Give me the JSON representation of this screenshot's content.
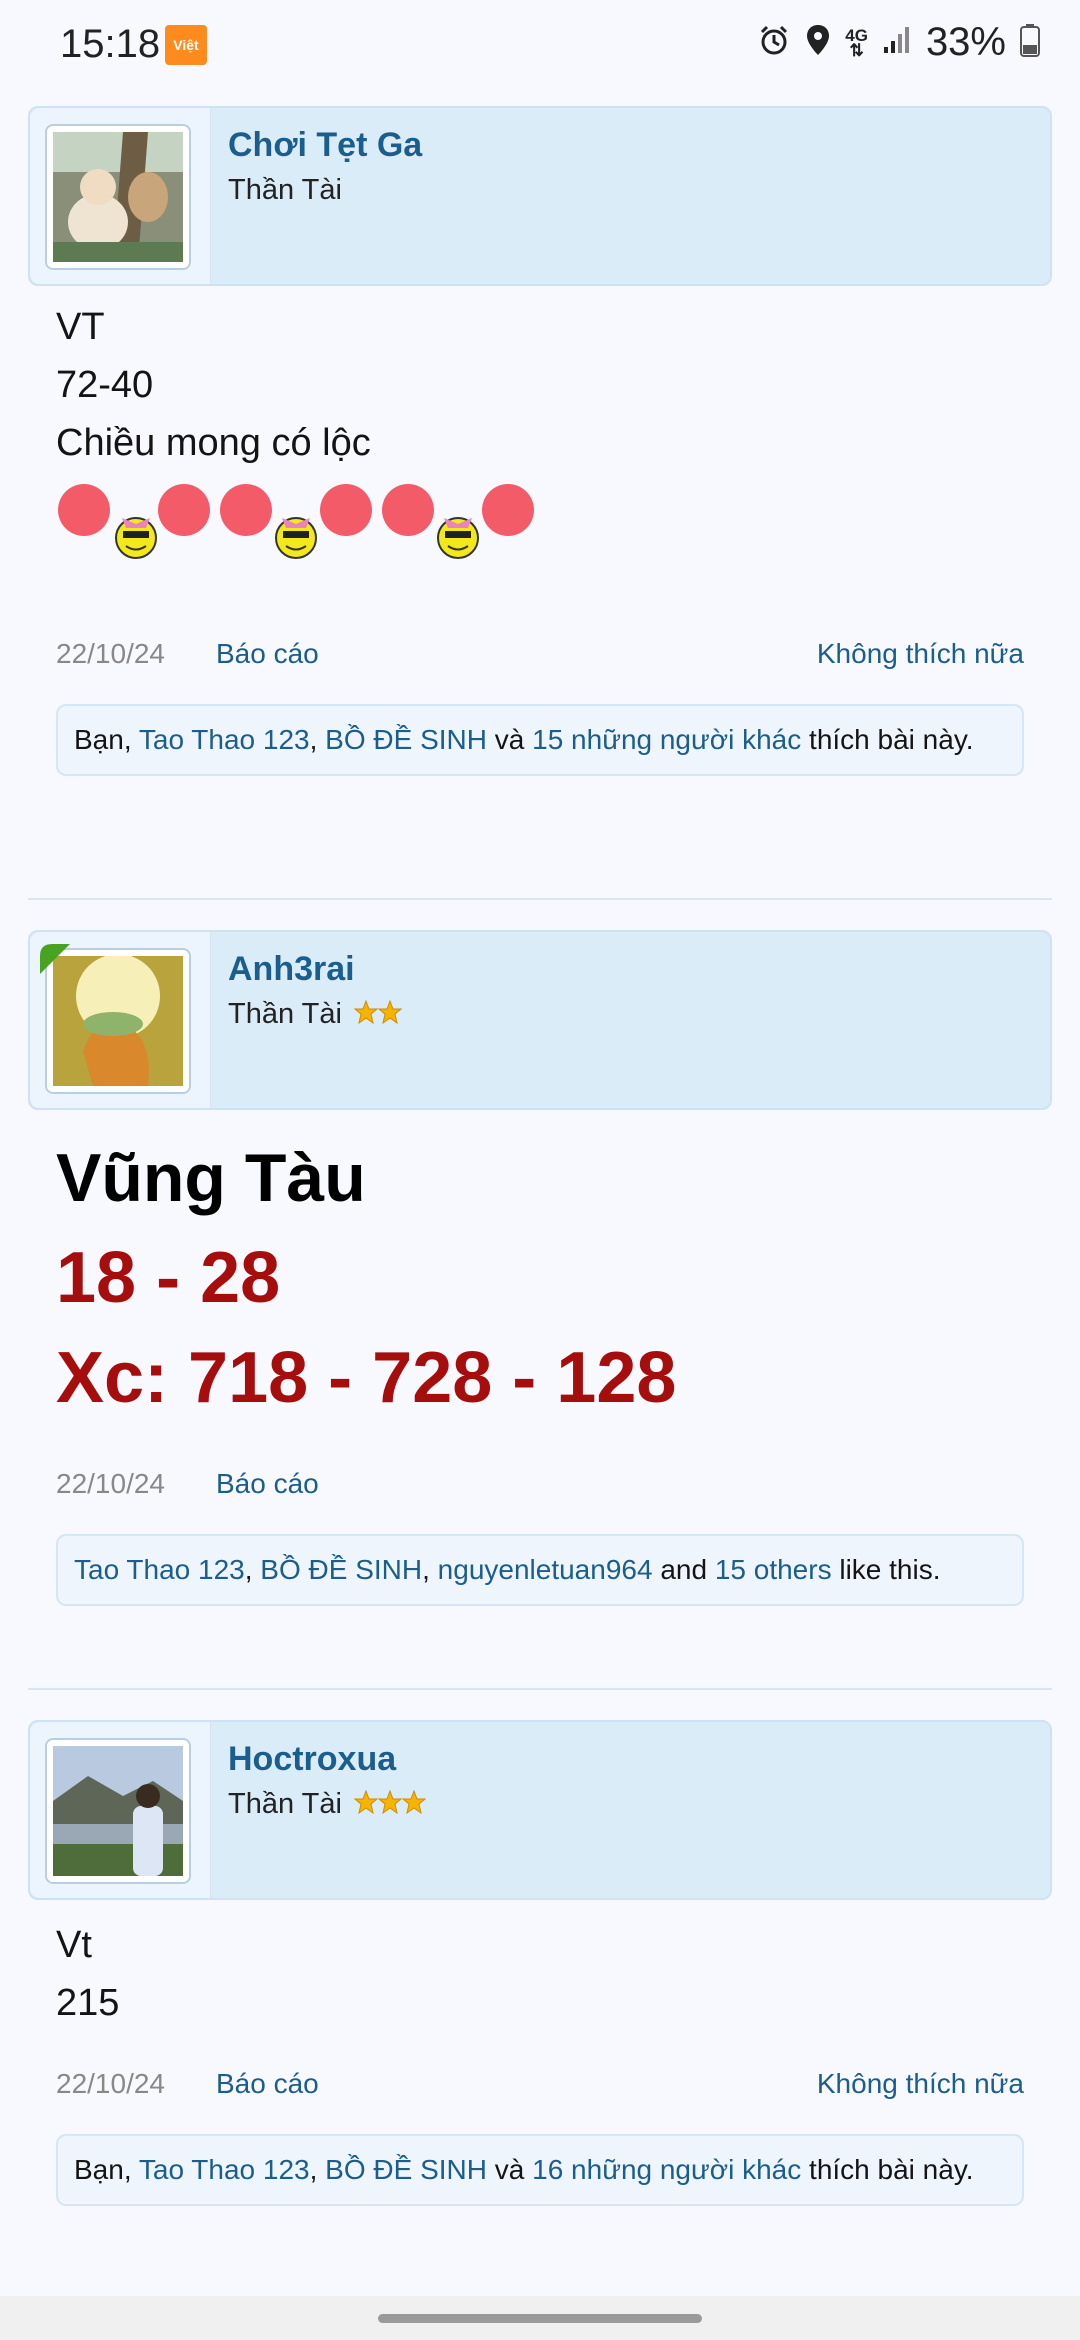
{
  "status_bar": {
    "time": "15:18",
    "app_badge": "Việt",
    "network": "4G",
    "battery": "33%"
  },
  "posts": [
    {
      "username": "Chơi Tẹt Ga",
      "title": "Thần Tài",
      "stars": 0,
      "message_lines": [
        "VT",
        "72-40",
        "Chiều mong có lộc"
      ],
      "date": "22/10/24",
      "report_label": "Báo cáo",
      "unlike_label": "Không thích nữa",
      "likes": {
        "prefix": "Bạn, ",
        "user1": "Tao Thao 123",
        "sep": ", ",
        "user2": "BỒ ĐỀ SINH",
        "and": " và ",
        "others": "15 những người khác",
        "suffix": " thích bài này."
      }
    },
    {
      "username": "Anh3rai",
      "title": "Thần Tài",
      "stars": 2,
      "message_lines": [
        "Vũng Tàu",
        "18 - 28",
        "Xc: 718 - 728 - 128"
      ],
      "date": "22/10/24",
      "report_label": "Báo cáo",
      "likes": {
        "user1": "Tao Thao 123",
        "sep1": ", ",
        "user2": "BỒ ĐỀ SINH",
        "sep2": ", ",
        "user3": "nguyenletuan964",
        "and": " and ",
        "others": "15 others",
        "suffix": " like this."
      }
    },
    {
      "username": "Hoctroxua",
      "title": "Thần Tài",
      "stars": 3,
      "message_lines": [
        "Vt",
        "215"
      ],
      "date": "22/10/24",
      "report_label": "Báo cáo",
      "unlike_label": "Không thích nữa",
      "likes": {
        "prefix": "Bạn, ",
        "user1": "Tao Thao 123",
        "sep": ", ",
        "user2": "BỒ ĐỀ SINH",
        "and": " và ",
        "others": "16 những người khác",
        "suffix": " thích bài này."
      }
    }
  ],
  "colors": {
    "accent": "#1b5d8d",
    "header_bg": "#dbecf9",
    "red_text": "#a60d0d",
    "star": "#f4b400"
  }
}
